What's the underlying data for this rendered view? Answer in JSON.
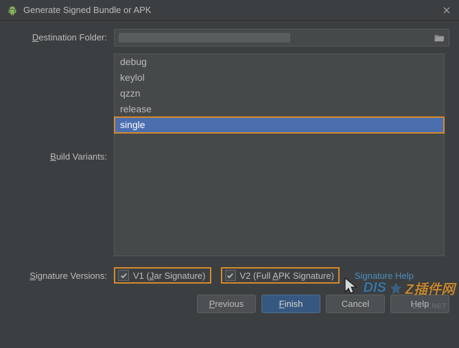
{
  "window": {
    "title": "Generate Signed Bundle or APK"
  },
  "labels": {
    "destination_prefix": "D",
    "destination_rest": "estination Folder:",
    "build_prefix": "B",
    "build_rest": "uild Variants:",
    "sig_prefix": "S",
    "sig_rest": "ignature Versions:"
  },
  "variants": {
    "items": [
      "debug",
      "keylol",
      "qzzn",
      "release",
      "single"
    ],
    "selected_index": 4
  },
  "signature": {
    "v1_prefix": "V1 (",
    "v1_u": "J",
    "v1_rest": "ar Signature)",
    "v2_prefix": "V2 (Full ",
    "v2_u": "A",
    "v2_rest": "PK Signature)",
    "v1_checked": true,
    "v2_checked": true,
    "help_label": "Signature Help"
  },
  "buttons": {
    "previous_u": "P",
    "previous_rest": "revious",
    "finish_u": "F",
    "finish_rest": "inish",
    "cancel": "Cancel",
    "help": "Help"
  },
  "watermark": {
    "t1": "DIS",
    "t2": "Z插件网",
    "sub": "DZ-X.NET"
  }
}
